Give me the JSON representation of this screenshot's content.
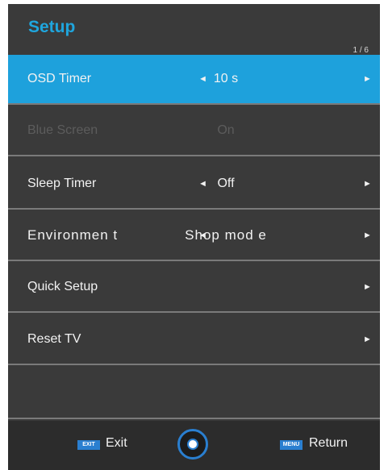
{
  "header": {
    "title": "Setup",
    "page_indicator": "1 / 6"
  },
  "menu": {
    "items": [
      {
        "label": "OSD Timer",
        "value": "10 s",
        "left_arrow": "◄",
        "right_arrow": "►"
      },
      {
        "label": "Blue Screen",
        "value": "On"
      },
      {
        "label": "Sleep Timer",
        "value": "Off",
        "left_arrow": "◄",
        "right_arrow": "►"
      },
      {
        "label": "Environmen t",
        "value": "Shop mod e",
        "left_arrow": "◄",
        "right_arrow": "►"
      },
      {
        "label": "Quick Setup",
        "right_arrow": "►"
      },
      {
        "label": "Reset TV",
        "right_arrow": "►"
      }
    ]
  },
  "footer": {
    "exit_key": "EXIT",
    "exit_label": "Exit",
    "menu_key": "MENU",
    "return_label": "Return"
  },
  "colors": {
    "accent": "#1ea1dc",
    "panel": "#3a3a3a",
    "footer": "#2c2c2c",
    "title": "#1fa6de"
  }
}
